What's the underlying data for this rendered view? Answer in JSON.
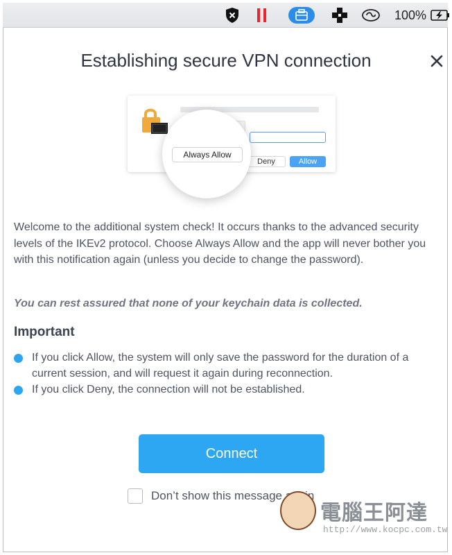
{
  "menubar": {
    "icons": [
      "shield-icon",
      "pause-icon",
      "briefcase-icon",
      "plus-cross-icon",
      "cloud-sync-icon"
    ],
    "battery_percent": "100%",
    "accent_red": "#e8262b",
    "accent_blue": "#2b8de8"
  },
  "dialog": {
    "title": "Establishing secure VPN connection",
    "illustration": {
      "always_allow_label": "Always Allow",
      "deny_label": "Deny",
      "allow_label": "Allow"
    },
    "paragraph": "Welcome to the additional system check! It occurs thanks to the advanced security levels of the IKEv2 protocol. Choose Always Allow and the app will never bother you with this notification again (unless you decide to change the password).",
    "assurance": "You can rest assured that none of your keychain data is collected.",
    "important_heading": "Important",
    "bullets": [
      "If you click Allow, the system will only save the password for the duration of a current session, and will request it again during reconnection.",
      "If you click Deny, the connection will not be established."
    ],
    "connect_label": "Connect",
    "dont_show_label": "Don’t show this message again",
    "accent": "#2ea7f3"
  },
  "watermark": {
    "text": "電腦王阿達",
    "url": "http://www.kocpc.com.tw"
  }
}
